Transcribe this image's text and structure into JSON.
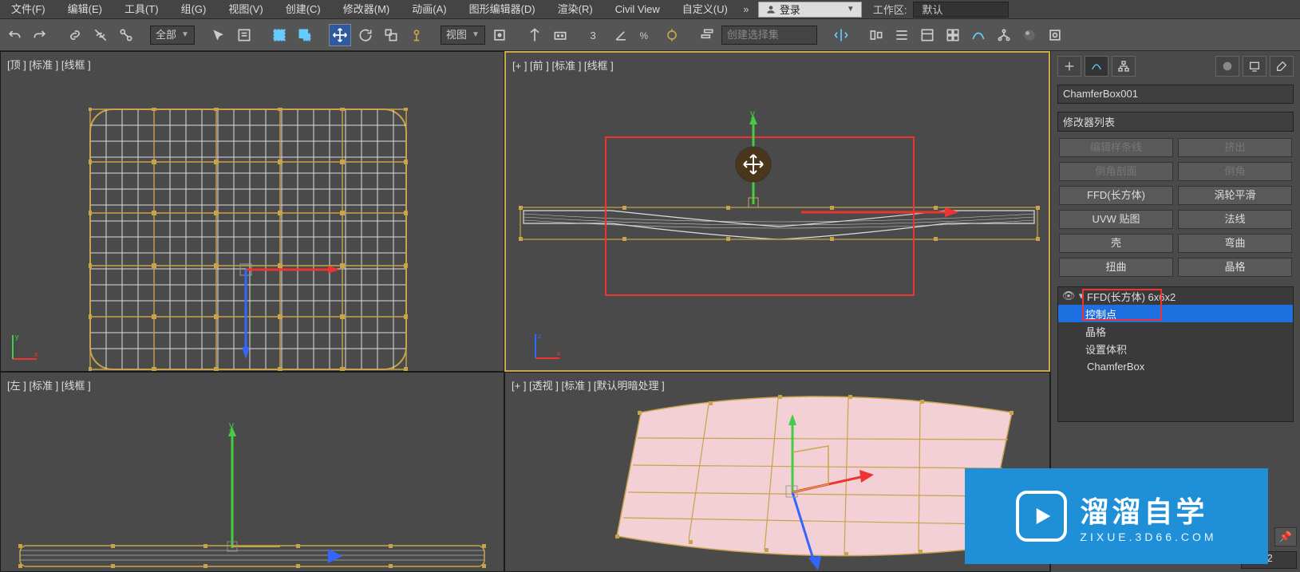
{
  "menu": {
    "file": "文件(F)",
    "edit": "编辑(E)",
    "tools": "工具(T)",
    "group": "组(G)",
    "view": "视图(V)",
    "create": "创建(C)",
    "modifiers": "修改器(M)",
    "animation": "动画(A)",
    "graph": "图形编辑器(D)",
    "render": "渲染(R)",
    "civil": "Civil View",
    "customize": "自定义(U)",
    "login": "登录",
    "workspace_label": "工作区:",
    "workspace_value": "默认"
  },
  "toolbar": {
    "selfilter": "全部",
    "coord": "视图",
    "selset": "创建选择集"
  },
  "viewports": {
    "top": "[顶 ] [标准 ] [线框 ]",
    "front": "[+ ] [前 ] [标准 ] [线框 ]",
    "left": "[左 ] [标准 ] [线框 ]",
    "persp": "[+ ] [透视 ] [标准 ] [默认明暗处理 ]"
  },
  "axis": {
    "x": "x",
    "y": "y",
    "z": "z"
  },
  "panel": {
    "object_name": "ChamferBox001",
    "modlist_label": "修改器列表",
    "buttons": {
      "editspline": "编辑样条线",
      "extrude": "挤出",
      "chamferprof": "倒角剖面",
      "chamfer": "倒角",
      "ffd_box": "FFD(长方体)",
      "turbosmooth": "涡轮平滑",
      "uvw": "UVW 贴图",
      "normals": "法线",
      "shell": "壳",
      "bend": "弯曲",
      "twist": "扭曲",
      "lattice": "晶格"
    },
    "stack": {
      "ffd": "FFD(长方体) 6x6x2",
      "ctrl": "控制点",
      "lattice": "晶格",
      "setvol": "设置体积",
      "base": "ChamferBox"
    },
    "pin": "📌",
    "params": "6x6x2"
  },
  "watermark": {
    "title": "溜溜自学",
    "sub": "ZIXUE.3D66.COM"
  }
}
